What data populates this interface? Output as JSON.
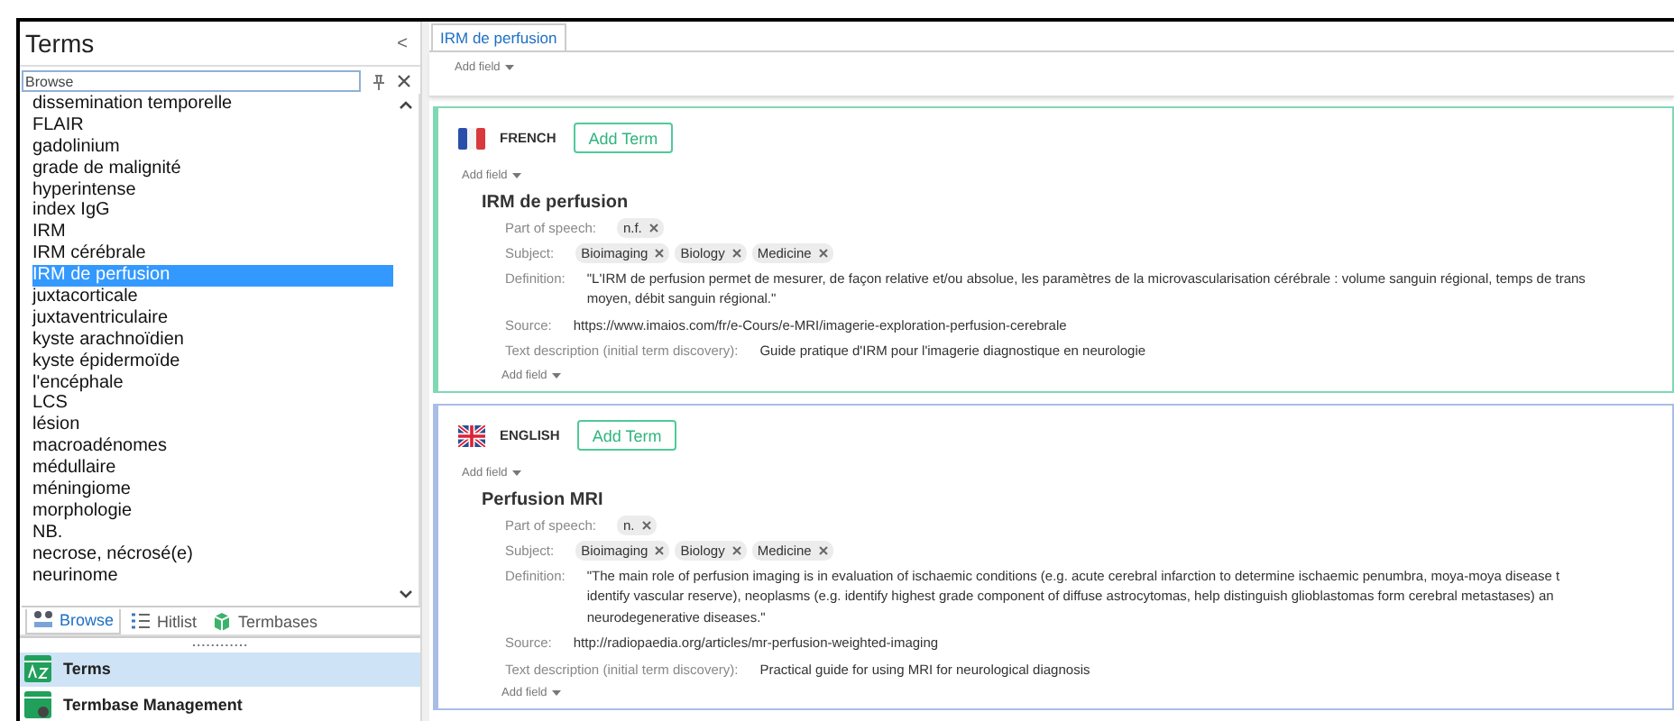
{
  "sidebar": {
    "title": "Terms",
    "collapse_glyph": "<",
    "search": {
      "placeholder": "Browse"
    },
    "items": [
      {
        "label": "dissemination temporelle",
        "selected": false
      },
      {
        "label": "FLAIR",
        "selected": false
      },
      {
        "label": "gadolinium",
        "selected": false
      },
      {
        "label": "grade de malignité",
        "selected": false
      },
      {
        "label": "hyperintense",
        "selected": false
      },
      {
        "label": "index IgG",
        "selected": false
      },
      {
        "label": "IRM",
        "selected": false
      },
      {
        "label": "IRM cérébrale",
        "selected": false
      },
      {
        "label": "IRM de perfusion",
        "selected": true
      },
      {
        "label": "juxtacorticale",
        "selected": false
      },
      {
        "label": "juxtaventriculaire",
        "selected": false
      },
      {
        "label": "kyste arachnoïdien",
        "selected": false
      },
      {
        "label": "kyste épidermoïde",
        "selected": false
      },
      {
        "label": "l'encéphale",
        "selected": false
      },
      {
        "label": "LCS",
        "selected": false
      },
      {
        "label": "lésion",
        "selected": false
      },
      {
        "label": "macroadénomes",
        "selected": false
      },
      {
        "label": "médullaire",
        "selected": false
      },
      {
        "label": "méningiome",
        "selected": false
      },
      {
        "label": "morphologie",
        "selected": false
      },
      {
        "label": "NB.",
        "selected": false
      },
      {
        "label": "necrose, nécrosé(e)",
        "selected": false
      },
      {
        "label": "neurinome",
        "selected": false
      }
    ],
    "view_tabs": [
      {
        "label": "Browse",
        "kind": "browse",
        "selected": true
      },
      {
        "label": "Hitlist",
        "kind": "hitlist",
        "selected": false
      },
      {
        "label": "Termbases",
        "kind": "termbases",
        "selected": false
      }
    ],
    "nav": [
      {
        "label": "Terms",
        "kind": "terms",
        "selected": true
      },
      {
        "label": "Termbase Management",
        "kind": "management",
        "selected": false
      }
    ]
  },
  "tabs": [
    {
      "label": "IRM de perfusion",
      "selected": true
    }
  ],
  "entry_add_field": "Add field",
  "languages": [
    {
      "language": "FRENCH",
      "kind": "french_flag",
      "color": "#7fd8b4",
      "add_term": "Add Term",
      "add_field": "Add field",
      "term": "IRM de perfusion",
      "fields": [
        {
          "kind": "tags",
          "label": "Part of speech:",
          "tags": [
            "n.f."
          ]
        },
        {
          "kind": "tags",
          "label": "Subject:",
          "tags": [
            "Bioimaging",
            "Biology",
            "Medicine"
          ]
        },
        {
          "kind": "text",
          "label": "Definition:",
          "value": "\"L'IRM de perfusion permet de mesurer, de façon relative et/ou absolue, les paramètres de la microvascularisation cérébrale : volume sanguin régional, temps de trans\nmoyen, débit sanguin régional.\""
        },
        {
          "kind": "text",
          "label": "Source:",
          "value": "https://www.imaios.com/fr/e-Cours/e-MRI/imagerie-exploration-perfusion-cerebrale"
        },
        {
          "kind": "text",
          "label": "Text description (initial term discovery):",
          "value": "Guide pratique d'IRM pour l'imagerie diagnostique en neurologie"
        }
      ],
      "bottom_add_field": "Add field"
    },
    {
      "language": "ENGLISH",
      "kind": "british_flag",
      "color": "#a9bde6",
      "add_term": "Add Term",
      "add_field": "Add field",
      "term": "Perfusion MRI",
      "fields": [
        {
          "kind": "tags",
          "label": "Part of speech:",
          "tags": [
            "n."
          ]
        },
        {
          "kind": "tags",
          "label": "Subject:",
          "tags": [
            "Bioimaging",
            "Biology",
            "Medicine"
          ]
        },
        {
          "kind": "text",
          "label": "Definition:",
          "value": "\"The main role of perfusion imaging is in evaluation of ischaemic conditions (e.g. acute cerebral infarction to determine ischaemic penumbra, moya-moya disease t\nidentify vascular reserve), neoplasms (e.g. identify highest grade component of diffuse astrocytomas, help distinguish glioblastomas form cerebral metastases) an\nneurodegenerative diseases.\""
        },
        {
          "kind": "text",
          "label": "Source:",
          "value": "http://radiopaedia.org/articles/mr-perfusion-weighted-imaging"
        },
        {
          "kind": "text",
          "label": "Text description (initial term discovery):",
          "value": "Practical guide for using MRI for neurological diagnosis"
        }
      ],
      "bottom_add_field": "Add field"
    }
  ]
}
